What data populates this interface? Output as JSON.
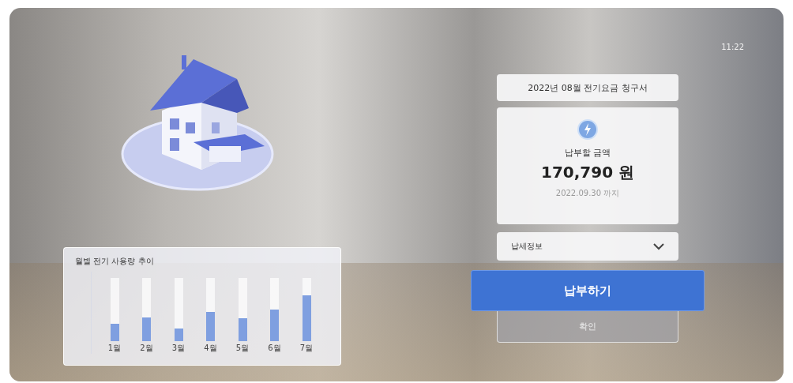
{
  "status_bar": {
    "time": "11:22"
  },
  "bill": {
    "title": "2022년 08월 전기요금 청구서",
    "amount_label": "납부할 금액",
    "amount": "170,790 원",
    "due": "2022.09.30 까지"
  },
  "dropdown": {
    "value": "납세정보",
    "expanded": false
  },
  "buttons": [
    {
      "label": "납부하기",
      "kind": "primary"
    },
    {
      "label": "확인",
      "kind": "secondary"
    }
  ],
  "usage_chart": {
    "title": "월별 전기 사용량 추이",
    "bars": [
      {
        "label": "1월",
        "level": 0.28
      },
      {
        "label": "2월",
        "level": 0.38
      },
      {
        "label": "3월",
        "level": 0.2
      },
      {
        "label": "4월",
        "level": 0.46
      },
      {
        "label": "5월",
        "level": 0.36
      },
      {
        "label": "6월",
        "level": 0.5
      },
      {
        "label": "7월",
        "level": 0.72
      }
    ]
  }
}
